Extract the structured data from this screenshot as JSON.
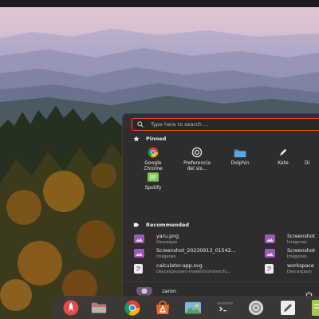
{
  "search": {
    "placeholder": "Type here to search ..."
  },
  "pinned": {
    "title": "Pinned",
    "apps": [
      {
        "label": "Google\nChrome",
        "icon": "chrome-icon"
      },
      {
        "label": "Preferencia\ndel sis...",
        "icon": "settings-icon"
      },
      {
        "label": "Dolphin",
        "icon": "folder-icon"
      },
      {
        "label": "Kate",
        "icon": "kate-pen-icon"
      },
      {
        "label": "Di",
        "icon": "app-icon-partial"
      },
      {
        "label": "Spotify",
        "icon": "spotify-icon"
      }
    ]
  },
  "recommended": {
    "title": "Recommended",
    "items": [
      {
        "name": "yaru.png",
        "sub": "Descargas",
        "icon": "image-file-icon"
      },
      {
        "name": "Screenshot_20230913_01542...",
        "sub": "Imágenes",
        "icon": "image-file-icon"
      },
      {
        "name": "calculator-app.svg",
        "sub": "Descargas/yaru-master/icons/src/fu...",
        "icon": "svg-file-icon"
      },
      {
        "name": "Screenshot",
        "sub": "Imágenes",
        "icon": "image-file-icon"
      },
      {
        "name": "Screenshot",
        "sub": "Imágenes",
        "icon": "image-file-icon"
      },
      {
        "name": "workspace",
        "sub": "Descargas/y",
        "icon": "svg-file-icon"
      }
    ]
  },
  "user": {
    "name": "zaron"
  },
  "dock": {
    "items": [
      "launcher-rocket-icon",
      "files-folder-icon",
      "chrome-icon",
      "store-icon",
      "image-viewer-icon",
      "terminal-icon",
      "settings-icon",
      "editor-icon",
      "notes-icon"
    ]
  },
  "colors": {
    "accent": "#e95420",
    "panel": "#302c2e",
    "image_file": "#9b59b6"
  }
}
